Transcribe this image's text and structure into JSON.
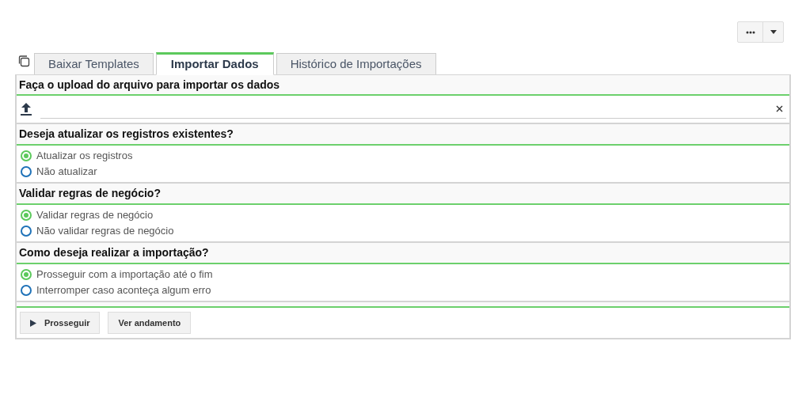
{
  "tabs": [
    {
      "label": "Baixar Templates",
      "selected": false
    },
    {
      "label": "Importar Dados",
      "selected": true
    },
    {
      "label": "Histórico de Importações",
      "selected": false
    }
  ],
  "upload": {
    "title": "Faça o upload do arquivo para importar os dados"
  },
  "questions": [
    {
      "title": "Deseja atualizar os registros existentes?",
      "options": [
        {
          "label": "Atualizar os registros",
          "selected": true
        },
        {
          "label": "Não atualizar",
          "selected": false
        }
      ]
    },
    {
      "title": "Validar regras de negócio?",
      "options": [
        {
          "label": "Validar regras de negócio",
          "selected": true
        },
        {
          "label": "Não validar regras de negócio",
          "selected": false
        }
      ]
    },
    {
      "title": "Como deseja realizar a importação?",
      "options": [
        {
          "label": "Prosseguir com a importação até o fim",
          "selected": true
        },
        {
          "label": "Interromper caso aconteça algum erro",
          "selected": false
        }
      ]
    }
  ],
  "buttons": [
    {
      "label": "Prosseguir",
      "kind": "play"
    },
    {
      "label": "Ver andamento",
      "kind": "plain"
    }
  ]
}
